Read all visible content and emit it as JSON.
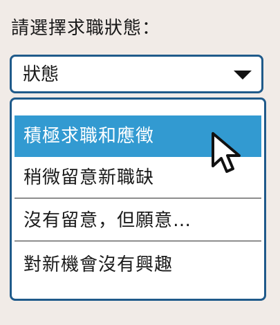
{
  "prompt_label": "請選擇求職狀態：",
  "select": {
    "value": "狀態",
    "caret_icon": "caret-down-icon"
  },
  "options": [
    {
      "label": "積極求職和應徵",
      "highlighted": true
    },
    {
      "label": "稍微留意新職缺",
      "highlighted": false
    },
    {
      "label": "沒有留意，但願意…",
      "highlighted": false
    },
    {
      "label": "對新機會沒有興趣",
      "highlighted": false
    }
  ],
  "cursor_icon": "mouse-pointer-icon",
  "colors": {
    "background": "#f1ebe7",
    "border": "#1f5a8a",
    "highlight": "#329ad1",
    "text": "#1a1a1a"
  }
}
